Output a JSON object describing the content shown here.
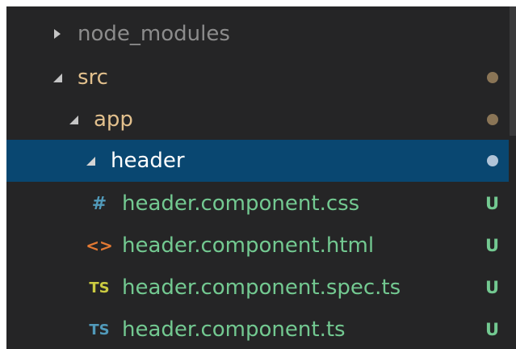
{
  "colors": {
    "panel_bg": "#252526",
    "selection_bg": "#094771",
    "folder_text": "#e2c08d",
    "muted_text": "#8c8c8c",
    "untracked_text": "#73c991",
    "twisty": "#c5c5c5",
    "css_icon": "#519aba",
    "html_icon": "#e37933",
    "spec_ts_icon": "#cbcb41",
    "ts_icon": "#519aba",
    "folder_dot": "#8a7556",
    "selected_dot": "#b0c4d8"
  },
  "tree": {
    "items": [
      {
        "label": "node_modules",
        "kind": "folder",
        "state": "collapsed",
        "icon": "chevron-right-icon"
      },
      {
        "label": "src",
        "kind": "folder",
        "state": "expanded",
        "icon": "chevron-down-icon",
        "decoration": "dot"
      },
      {
        "label": "app",
        "kind": "folder",
        "state": "expanded",
        "icon": "chevron-down-icon",
        "decoration": "dot"
      },
      {
        "label": "header",
        "kind": "folder",
        "state": "expanded",
        "selected": true,
        "icon": "chevron-down-icon",
        "decoration": "dot"
      },
      {
        "label": "header.component.css",
        "kind": "file",
        "icon_glyph": "#",
        "icon": "css-file-icon",
        "badge": "U"
      },
      {
        "label": "header.component.html",
        "kind": "file",
        "icon_glyph": "<>",
        "icon": "html-file-icon",
        "badge": "U"
      },
      {
        "label": "header.component.spec.ts",
        "kind": "file",
        "icon_glyph": "TS",
        "icon": "spec-ts-file-icon",
        "badge": "U"
      },
      {
        "label": "header.component.ts",
        "kind": "file",
        "icon_glyph": "TS",
        "icon": "ts-file-icon",
        "badge": "U"
      }
    ]
  }
}
